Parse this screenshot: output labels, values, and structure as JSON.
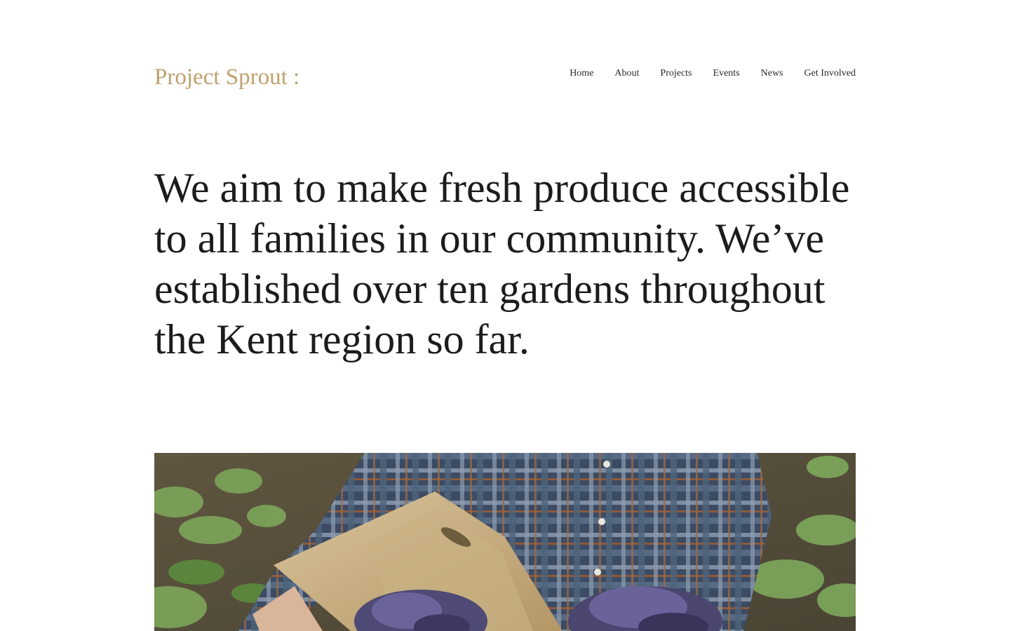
{
  "header": {
    "site_title": "Project Sprout :",
    "nav": [
      {
        "label": "Home"
      },
      {
        "label": "About"
      },
      {
        "label": "Projects"
      },
      {
        "label": "Events"
      },
      {
        "label": "News"
      },
      {
        "label": "Get Involved"
      }
    ]
  },
  "hero": {
    "statement": "We aim to make fresh produce accessible to all families in our community. We’ve established over ten gardens throughout the Kent region so far."
  },
  "image": {
    "description": "person-in-plaid-shirt-holding-wooden-crate-of-purple-cabbage"
  },
  "colors": {
    "brand": "#c0a06c",
    "text": "#1c1c1c",
    "background": "#ffffff"
  }
}
